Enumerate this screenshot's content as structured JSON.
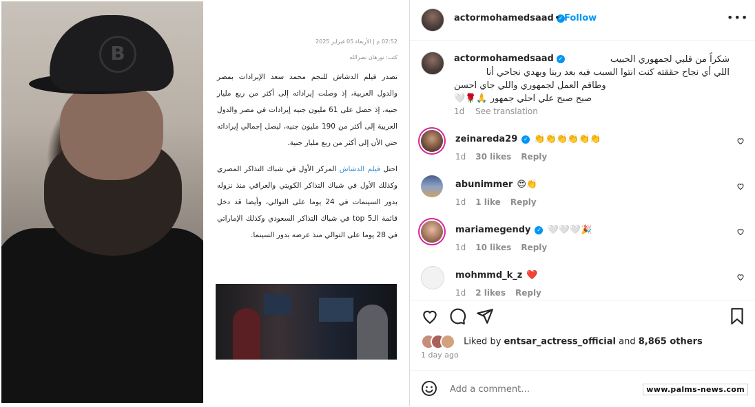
{
  "article": {
    "meta_date": "02:52 م | الأربعاء 05 فبراير 2025",
    "author": "كتب: نورهان نصرالله",
    "para1": "تصدر فيلم الدشاش للنجم محمد سعد الإيرادات بمصر والدول العربية، إذ وصلت إيراداته إلى أكثر من ربع مليار جنيه، إذ حصل على 61 مليون جنيه إيرادات في مصر والدول العربية إلى أكثر من 190 مليون جنيه، ليصل إجمالي إيراداته حتي الأن إلى أكثر من ربع مليار جنية.",
    "para2_pre": "احتل ",
    "para2_link": "فيلم الدشاش",
    "para2_post": " المركز الأول في شباك التذاكر المصري وكذلك الأول في شباك التذاكر الكويتي والعراقي منذ نزوله بدور السينمات في 24 يوما على التوالي، وأيضا قد دخل قائمة الـ5 top في شباك التذاكر السعودي وكذلك الإماراتي في 28 يوما على التوالي منذ عرضه بدور السينما."
  },
  "post": {
    "username": "actormohamedsaad",
    "follow_label": "Follow",
    "dot": "•",
    "more": "•••",
    "caption_lines": [
      "شكراً من قلبي لجمهوري الحبيب",
      "اللي أي نجاح حققته كنت انتوا السبب فيه بعد ربنا وبهدي نجاحي أنا",
      "وطاقم العمل لجمهوري واللي جاي احسن",
      "صبح صبح علي احلي جمهور 🙏🌹🤍"
    ],
    "caption_time": "1d",
    "see_translation": "See translation",
    "likes_prefix": "Liked by",
    "likes_user": "entsar_actress_official",
    "likes_mid": "and",
    "likes_count": "8,865 others",
    "time_ago": "1 day ago",
    "add_comment_placeholder": "Add a comment…"
  },
  "comments": [
    {
      "user": "zeinareda29",
      "text": "👏👏👏👏👏👏",
      "time": "1d",
      "likes": "30 likes",
      "reply": "Reply"
    },
    {
      "user": "abunimmer",
      "text": "😍👏",
      "time": "1d",
      "likes": "1 like",
      "reply": "Reply"
    },
    {
      "user": "mariamegendy",
      "text": "🤍🤍🤍🎉",
      "time": "1d",
      "likes": "10 likes",
      "reply": "Reply"
    },
    {
      "user": "mohmmd_k_z",
      "text": "❤️",
      "time": "1d",
      "likes": "2 likes",
      "reply": "Reply"
    }
  ],
  "watermark": "www.palms-news.com",
  "colors": {
    "accent": "#0095f6",
    "link": "#3a8ed1",
    "muted": "#8e8e8e"
  },
  "icons": [
    "heart-icon",
    "comment-icon",
    "share-icon",
    "bookmark-icon",
    "emoji-icon",
    "verified-icon",
    "more-icon"
  ]
}
